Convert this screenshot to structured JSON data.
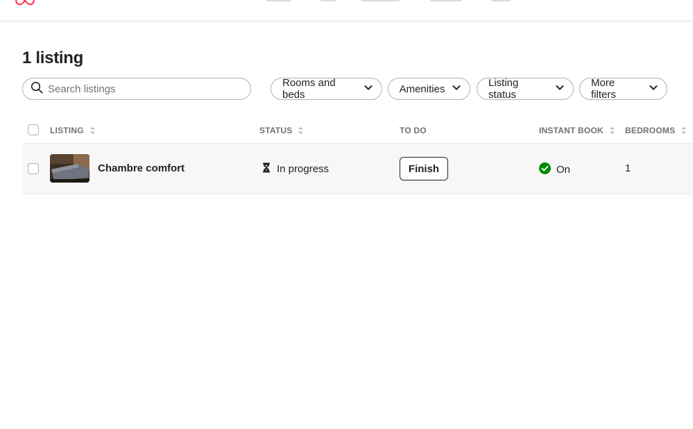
{
  "header": {
    "logo_icon": "airbnb-logo-icon",
    "brand_color": "#FF385C"
  },
  "page": {
    "title": "1 listing"
  },
  "search": {
    "placeholder": "Search listings",
    "value": "",
    "icon": "search-icon"
  },
  "filters": [
    {
      "label": "Rooms and beds",
      "icon": "chevron-down-icon"
    },
    {
      "label": "Amenities",
      "icon": "chevron-down-icon"
    },
    {
      "label": "Listing status",
      "icon": "chevron-down-icon"
    },
    {
      "label": "More filters",
      "icon": "chevron-down-icon"
    }
  ],
  "table": {
    "columns": [
      {
        "label": "LISTING",
        "sortable": true
      },
      {
        "label": "STATUS",
        "sortable": true
      },
      {
        "label": "TO DO",
        "sortable": false
      },
      {
        "label": "INSTANT BOOK",
        "sortable": true
      },
      {
        "label": "BEDROOMS",
        "sortable": true
      }
    ],
    "rows": [
      {
        "name": "Chambre comfort",
        "status": "In progress",
        "status_icon": "hourglass-icon",
        "todo_action": "Finish",
        "instant_book": "On",
        "instant_book_icon": "check-circle-icon",
        "instant_book_color": "#008A05",
        "bedrooms": "1"
      }
    ]
  }
}
